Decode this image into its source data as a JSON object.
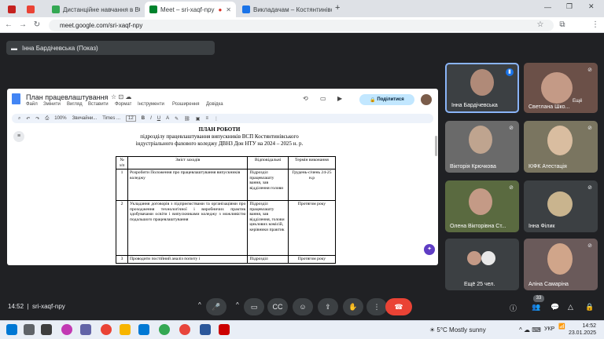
{
  "browser": {
    "tabs": [
      {
        "label": "",
        "color": "#c5221f"
      },
      {
        "label": "",
        "color": "#ea4335"
      },
      {
        "label": "Дистанційне навчання в ВСП",
        "color": "#34a853"
      },
      {
        "label": "Meet – sri-xaqf-npy",
        "color": "#00832d"
      },
      {
        "label": "Викладачам – Костянтинівськ",
        "color": "#1a73e8"
      }
    ],
    "url": "meet.google.com/sri-xaqf-npy"
  },
  "meet": {
    "presenter_label": "Інна Бардічевська (Показ)",
    "clock": "14:52",
    "meeting_code": "sri-xaqf-npy",
    "participants_count": "33"
  },
  "doc": {
    "title": "План працевлаштування",
    "menus": [
      "Файл",
      "Змінити",
      "Вигляд",
      "Вставити",
      "Формат",
      "Інструменти",
      "Розширення",
      "Довідка"
    ],
    "share_label": "Поділитися",
    "zoom": "100%",
    "style": "Звичайни...",
    "font": "Times ...",
    "font_size": "12",
    "heading": "ПЛАН РОБОТИ",
    "sub1": "підрозділу працевлаштування випускників ВСП Костянтинівського",
    "sub2": "індустріального фахового коледжу ДВНЗ Дон НТУ на 2024 – 2025 н. р.",
    "table_header": [
      "№ з/п",
      "Зміст заходів",
      "Відповідальні",
      "Термін виконання"
    ],
    "rows": [
      {
        "n": "1",
        "text": "Розробити Положення про працевлаштування випускників коледжу",
        "resp": "Підрозділ працевлашту вання, зав відділення голови",
        "term": "Грудень-січень 24-25 н.р"
      },
      {
        "n": "2",
        "text": "Укладання договорів з підприємствами та організаціями про проходження технологічної і виробничих практик здобувачами освіти і випускниками коледжу з можливістю подальшого працевлаштування",
        "resp": "Підрозділ працевлашту вання, зав відділення, голови циклових комісій, керівники практик",
        "term": "Протягом року"
      },
      {
        "n": "3",
        "text": "Проводити постійний аналіз попиту і",
        "resp": "Підрозділ",
        "term": "Протягом року"
      }
    ]
  },
  "participants": [
    {
      "name": "Інна Бардічевська",
      "color": "#8a7060"
    },
    {
      "name": "Светлана Шко...",
      "color": "#6b5048",
      "extra": "Ещё"
    },
    {
      "name": "Вікторія Крючкова",
      "color": "#6a6a6a"
    },
    {
      "name": "КІФК Атестація",
      "color": "#7a7560"
    },
    {
      "name": "Олена Вікторівна Ст...",
      "color": "#5a6a40"
    },
    {
      "name": "Інна Філик",
      "color": "#8a6a50"
    },
    {
      "name": "Ещё 25 чел.",
      "color": "#3c4043"
    },
    {
      "name": "Аліна Самаріна",
      "color": "#6a5a5a"
    }
  ],
  "taskbar": {
    "weather": "5°C  Mostly sunny",
    "lang": "УКР",
    "time": "14:52",
    "date": "23.01.2025"
  }
}
